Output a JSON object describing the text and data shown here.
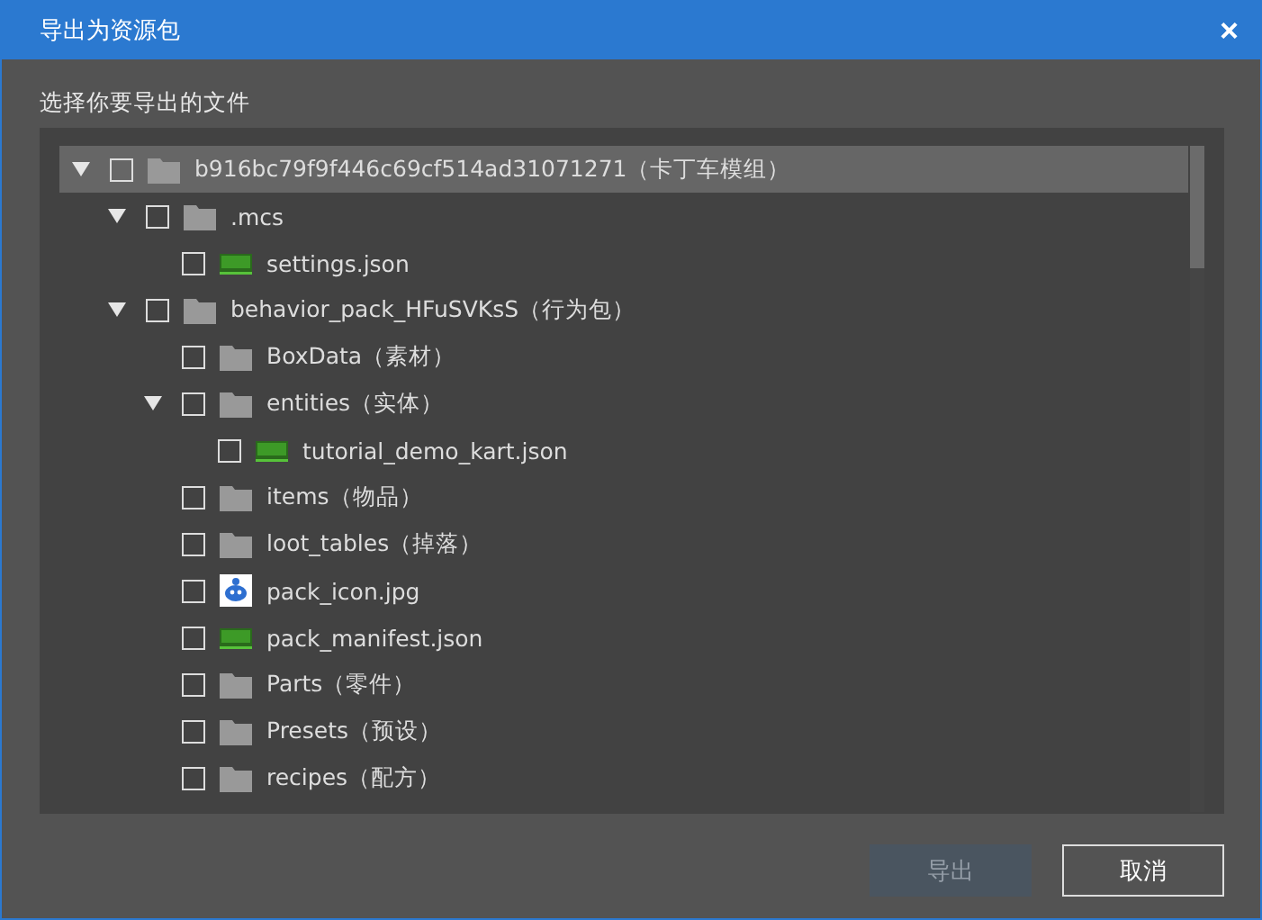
{
  "window": {
    "title": "导出为资源包",
    "close": "×"
  },
  "prompt": "选择你要导出的文件",
  "tree": [
    {
      "label": "b916bc79f9f446c69cf514ad31071271（卡丁车模组）",
      "kind": "folder",
      "expanded": true,
      "checked": false,
      "selected": true,
      "children": [
        {
          "label": ".mcs",
          "kind": "folder",
          "expanded": true,
          "checked": false,
          "selected": false,
          "children": [
            {
              "label": "settings.json",
              "kind": "json",
              "checked": false,
              "selected": false
            }
          ]
        },
        {
          "label": "behavior_pack_HFuSVKsS（行为包）",
          "kind": "folder",
          "expanded": true,
          "checked": false,
          "selected": false,
          "children": [
            {
              "label": "BoxData（素材）",
              "kind": "folder",
              "checked": false,
              "selected": false
            },
            {
              "label": "entities（实体）",
              "kind": "folder",
              "expanded": true,
              "checked": false,
              "selected": false,
              "children": [
                {
                  "label": "tutorial_demo_kart.json",
                  "kind": "json",
                  "checked": false,
                  "selected": false
                }
              ]
            },
            {
              "label": "items（物品）",
              "kind": "folder",
              "checked": false,
              "selected": false
            },
            {
              "label": "loot_tables（掉落）",
              "kind": "folder",
              "checked": false,
              "selected": false
            },
            {
              "label": "pack_icon.jpg",
              "kind": "image",
              "checked": false,
              "selected": false
            },
            {
              "label": "pack_manifest.json",
              "kind": "json",
              "checked": false,
              "selected": false
            },
            {
              "label": "Parts（零件）",
              "kind": "folder",
              "checked": false,
              "selected": false
            },
            {
              "label": "Presets（预设）",
              "kind": "folder",
              "checked": false,
              "selected": false
            },
            {
              "label": "recipes（配方）",
              "kind": "folder",
              "checked": false,
              "selected": false
            }
          ]
        }
      ]
    }
  ],
  "buttons": [
    {
      "label": "导出",
      "disabled": true
    },
    {
      "label": "取消",
      "disabled": false
    }
  ]
}
